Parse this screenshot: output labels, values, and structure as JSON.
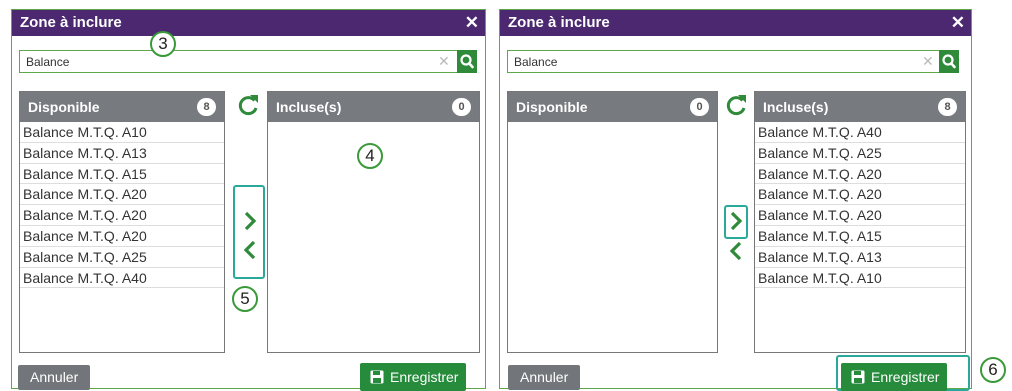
{
  "left": {
    "title": "Zone à inclure",
    "search_value": "Balance",
    "available": {
      "label": "Disponible",
      "count": "8",
      "items": [
        "Balance M.T.Q. A10",
        "Balance M.T.Q. A13",
        "Balance M.T.Q. A15",
        "Balance M.T.Q. A20",
        "Balance M.T.Q. A20",
        "Balance M.T.Q. A20",
        "Balance M.T.Q. A25",
        "Balance M.T.Q. A40"
      ]
    },
    "included": {
      "label": "Incluse(s)",
      "count": "0",
      "items": []
    },
    "cancel_label": "Annuler",
    "save_label": "Enregistrer"
  },
  "right": {
    "title": "Zone à inclure",
    "search_value": "Balance",
    "available": {
      "label": "Disponible",
      "count": "0",
      "items": []
    },
    "included": {
      "label": "Incluse(s)",
      "count": "8",
      "items": [
        "Balance M.T.Q. A40",
        "Balance M.T.Q. A25",
        "Balance M.T.Q. A20",
        "Balance M.T.Q. A20",
        "Balance M.T.Q. A20",
        "Balance M.T.Q. A15",
        "Balance M.T.Q. A13",
        "Balance M.T.Q. A10"
      ]
    },
    "cancel_label": "Annuler",
    "save_label": "Enregistrer"
  },
  "callouts": {
    "search": "3",
    "included_list": "4",
    "move_buttons": "5",
    "save": "6"
  },
  "icons": {
    "close": "close-icon",
    "clear": "clear-icon",
    "search": "search-icon",
    "refresh": "refresh-icon",
    "move_right": "chevron-right-icon",
    "move_left": "chevron-left-icon",
    "save": "floppy-disk-icon"
  },
  "colors": {
    "titlebar": "#4b2870",
    "accent_green": "#2f8a3a",
    "list_header": "#777b80",
    "callout_teal": "#2aa99a"
  }
}
